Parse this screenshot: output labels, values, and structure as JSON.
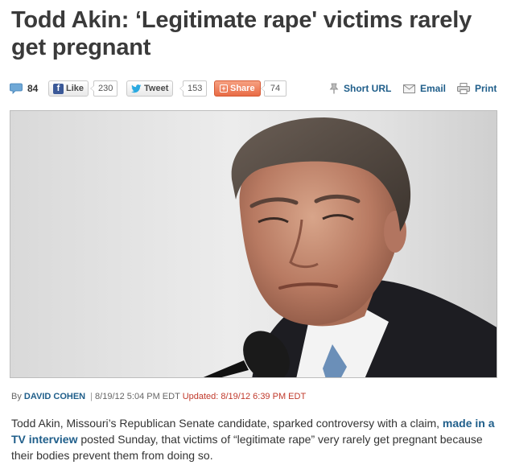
{
  "article": {
    "headline": "Todd Akin: ‘Legitimate rape' victims rarely get pregnant",
    "byline": {
      "prefix": "By",
      "author": "DAVID COHEN",
      "separator": "|",
      "published": "8/19/12 5:04 PM EDT",
      "updated": "Updated: 8/19/12 6:39 PM EDT"
    },
    "summary": {
      "before_link": "Todd Akin, Missouri’s Republican Senate candidate, sparked controversy with a claim, ",
      "link_text": "made in a TV interview",
      "after_link": " posted Sunday, that victims of “legitimate rape” very rarely get pregnant because their bodies prevent them from doing so."
    }
  },
  "share_bar": {
    "comments_count": "84",
    "facebook": {
      "label": "Like",
      "count": "230"
    },
    "twitter": {
      "label": "Tweet",
      "count": "153"
    },
    "share": {
      "label": "Share",
      "count": "74"
    },
    "short_url_label": "Short URL",
    "email_label": "Email",
    "print_label": "Print"
  },
  "icons": {
    "comments": "speech-bubble-icon",
    "facebook": "facebook-f-icon",
    "twitter": "twitter-bird-icon",
    "share": "plus-box-icon",
    "short_url": "pushpin-icon",
    "email": "envelope-icon",
    "print": "printer-icon"
  },
  "colors": {
    "link": "#1f5e8a",
    "updated": "#c0392b",
    "facebook": "#3b5998",
    "share": "#e86b45",
    "headline": "#3a3a3a"
  }
}
